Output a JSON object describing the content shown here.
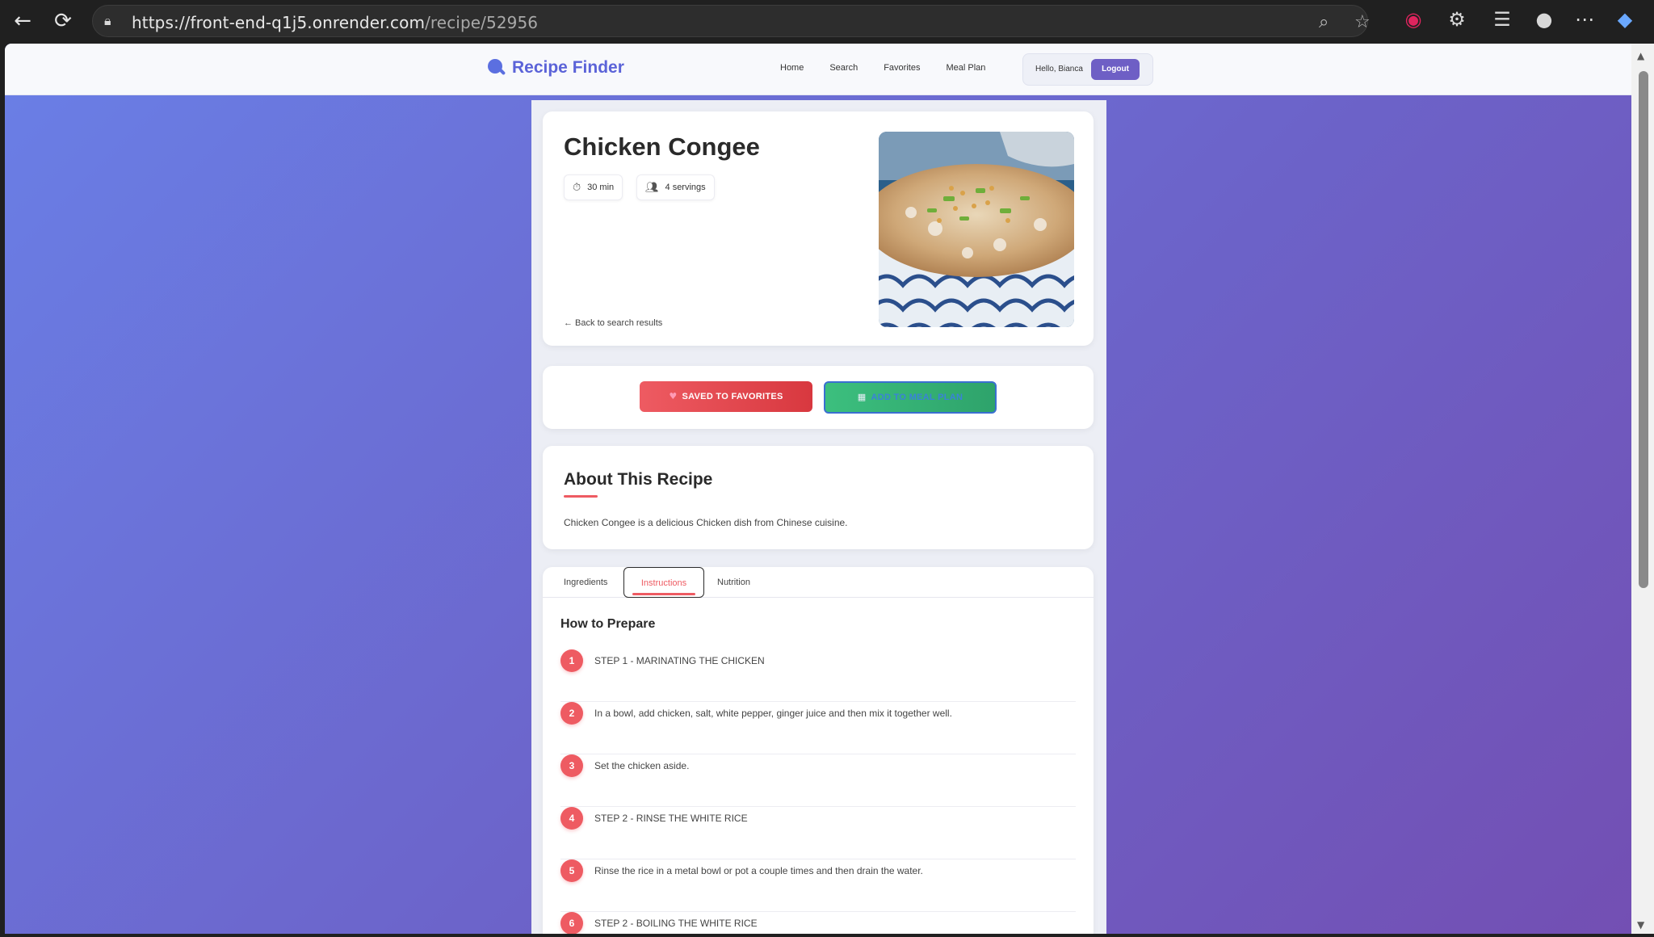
{
  "browser": {
    "url_host": "https://front-end-q1j5.onrender.com",
    "url_path": "/recipe/52956"
  },
  "site": {
    "logo_text": "Recipe Finder",
    "nav": [
      "Home",
      "Search",
      "Favorites",
      "Meal Plan"
    ],
    "greeting": "Hello, Bianca",
    "logout_label": "Logout"
  },
  "recipe": {
    "title": "Chicken Congee",
    "time": "30 min",
    "servings": "4 servings",
    "back_link": "← Back to search results",
    "favorite_label": "SAVED TO FAVORITES",
    "meal_plan_label": "ADD TO MEAL PLAN",
    "about_title": "About This Recipe",
    "about_text": "Chicken Congee is a delicious Chicken dish from Chinese cuisine.",
    "tabs": [
      "Ingredients",
      "Instructions",
      "Nutrition"
    ],
    "active_tab": "Instructions",
    "instructions_title": "How to Prepare",
    "steps": [
      {
        "num": "1",
        "text": "STEP 1 - MARINATING THE CHICKEN"
      },
      {
        "num": "2",
        "text": "In a bowl, add chicken, salt, white pepper, ginger juice and then mix it together well."
      },
      {
        "num": "3",
        "text": "Set the chicken aside."
      },
      {
        "num": "4",
        "text": "STEP 2 - RINSE THE WHITE RICE"
      },
      {
        "num": "5",
        "text": "Rinse the rice in a metal bowl or pot a couple times and then drain the water."
      },
      {
        "num": "6",
        "text": "STEP 2 - BOILING THE WHITE RICE"
      }
    ]
  },
  "colors": {
    "accent": "#ee5b62",
    "brand": "#5b63d8",
    "meal_plan_green": "#3cbf7e"
  }
}
